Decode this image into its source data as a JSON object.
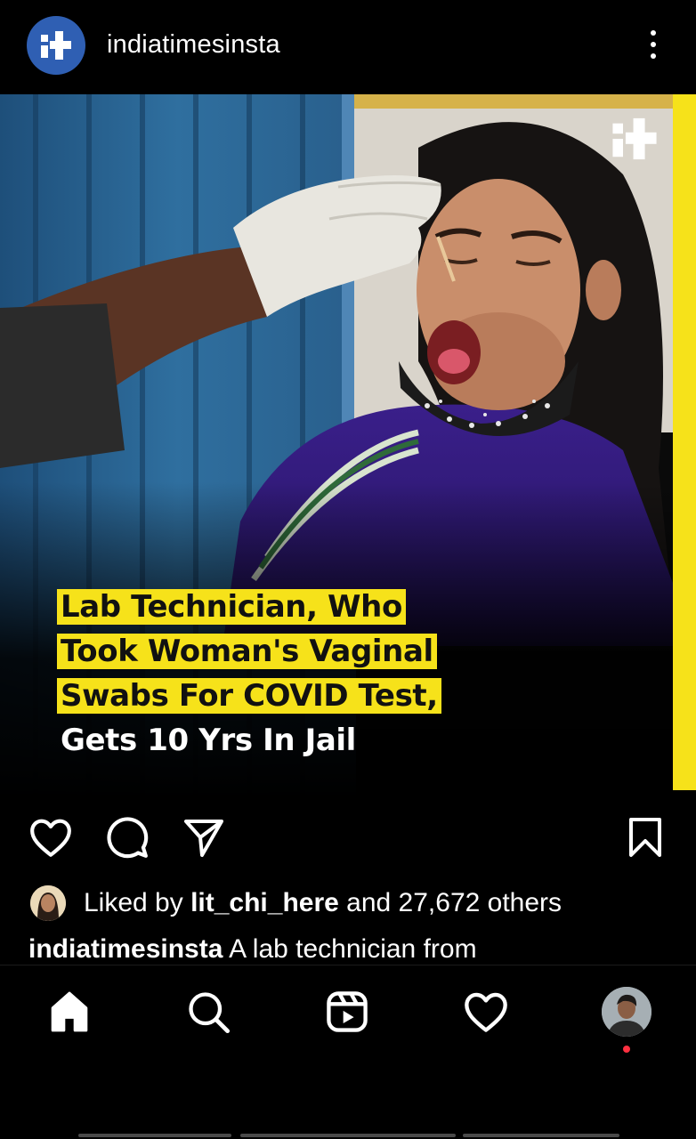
{
  "header": {
    "account": "indiatimesinsta",
    "logo_icon": "indiatimes-plus-logo",
    "more_icon": "three-dots-vertical"
  },
  "post": {
    "headline_highlighted": [
      "Lab Technician, Who",
      "Took Woman's Vaginal",
      "Swabs For COVID Test,"
    ],
    "headline_plain": "Gets 10 Yrs In Jail",
    "accent_color": "#f6e21a",
    "brand_color": "#2f5fb3"
  },
  "actions": {
    "like_icon": "heart-icon",
    "comment_icon": "comment-icon",
    "share_icon": "send-icon",
    "save_icon": "bookmark-icon"
  },
  "likes": {
    "prefix": "Liked by ",
    "user": "lit_chi_here",
    "suffix": " and 27,672 others"
  },
  "caption": {
    "user": "indiatimesinsta",
    "text": " A lab technician from"
  },
  "nav": {
    "items": [
      "home",
      "search",
      "reels",
      "activity",
      "profile"
    ]
  }
}
